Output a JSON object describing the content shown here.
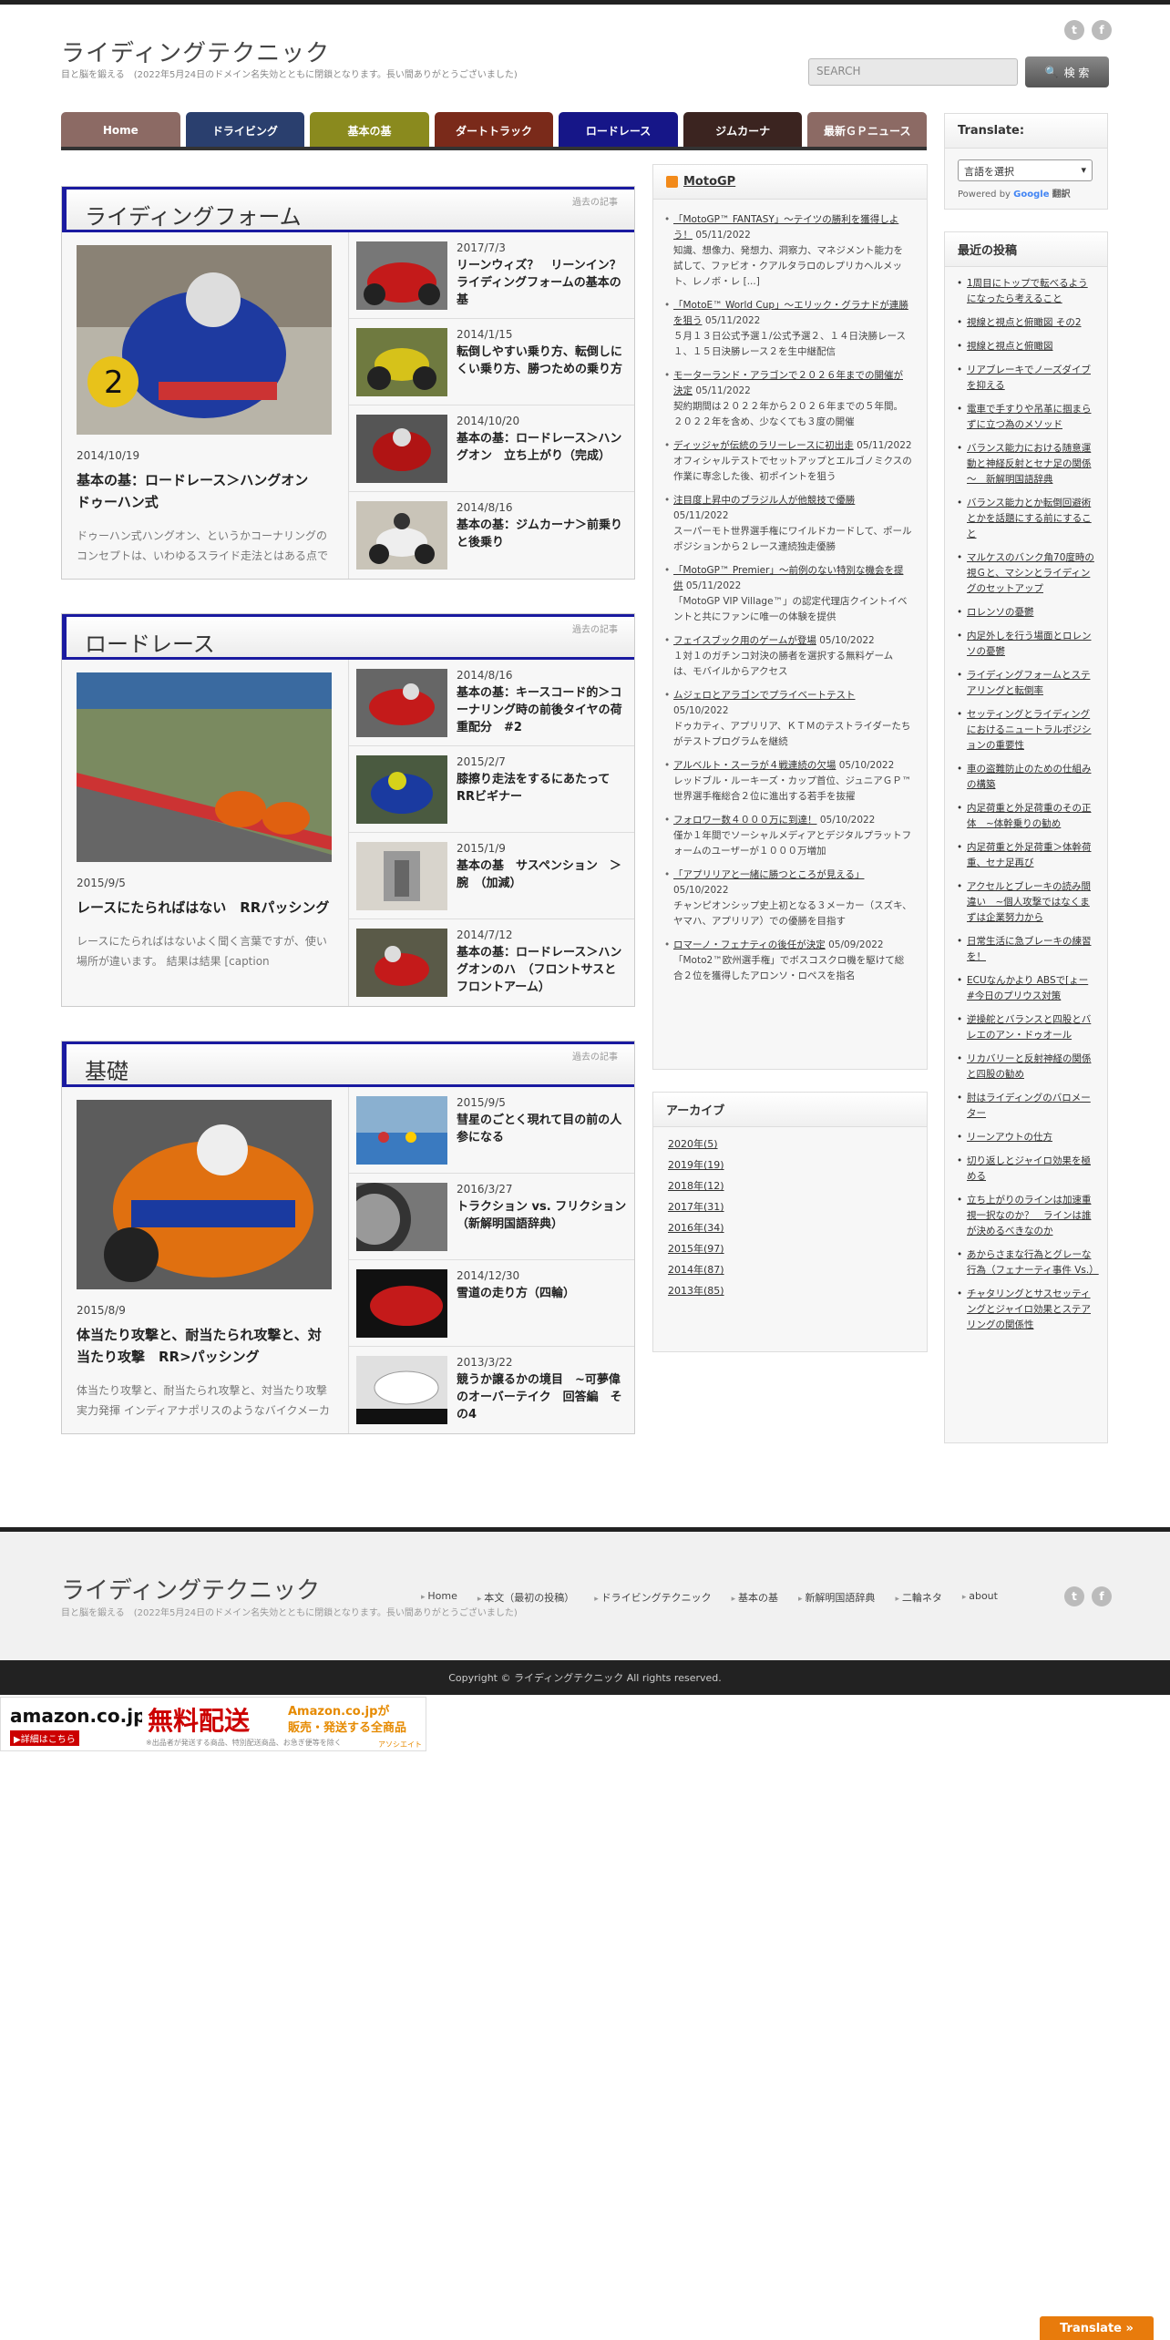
{
  "header": {
    "site_title": "ライディングテクニック",
    "site_desc": "目と脳を鍛える　(2022年5月24日のドメイン名失効とともに閉鎖となります。長い間ありがとうございました)",
    "search_placeholder": "SEARCH",
    "search_button": "検 索"
  },
  "nav": [
    {
      "label": "Home",
      "color": "#8c6a64"
    },
    {
      "label": "ドライビング",
      "color": "#2a3f6e"
    },
    {
      "label": "基本の基",
      "color": "#8a8a1e"
    },
    {
      "label": "ダートトラック",
      "color": "#7a2a1a"
    },
    {
      "label": "ロードレース",
      "color": "#161688"
    },
    {
      "label": "ジムカーナ",
      "color": "#3b2420"
    },
    {
      "label": "最新ＧＰニュース",
      "color": "#8c6a64"
    }
  ],
  "sections": [
    {
      "title": "ライディングフォーム",
      "more": "過去の記事",
      "feature": {
        "date": "2014/10/19",
        "title": "基本の基：ロードレース＞ハングオン　ドゥーハン式",
        "excerpt": "ドゥーハン式ハングオン、というかコーナリングのコンセプトは、いわゆるスライド走法とはある点で"
      },
      "items": [
        {
          "date": "2017/7/3",
          "title": "リーンウィズ？　リーンイン？　ライディングフォームの基本の基"
        },
        {
          "date": "2014/1/15",
          "title": "転倒しやすい乗り方、転倒しにくい乗り方、勝つための乗り方"
        },
        {
          "date": "2014/10/20",
          "title": "基本の基：ロードレース＞ハングオン　立ち上がり（完成）"
        },
        {
          "date": "2014/8/16",
          "title": "基本の基：ジムカーナ＞前乗りと後乗り"
        }
      ]
    },
    {
      "title": "ロードレース",
      "more": "過去の記事",
      "feature": {
        "date": "2015/9/5",
        "title": "レースにたらればはない　RRパッシング",
        "excerpt": "レースにたらればはないよく聞く言葉ですが、使い場所が違います。 結果は結果 [caption"
      },
      "items": [
        {
          "date": "2014/8/16",
          "title": "基本の基：キースコード的＞コーナリング時の前後タイヤの荷重配分　#2"
        },
        {
          "date": "2015/2/7",
          "title": "膝擦り走法をするにあたってRRビギナー"
        },
        {
          "date": "2015/1/9",
          "title": "基本の基　サスペンション　＞　腕　（加減）"
        },
        {
          "date": "2014/7/12",
          "title": "基本の基：ロードレース＞ハングオンのハ　（フロントサスとフロントアーム）"
        }
      ]
    },
    {
      "title": "基礎",
      "more": "過去の記事",
      "feature": {
        "date": "2015/8/9",
        "title": "体当たり攻撃と、耐当たられ攻撃と、対当たり攻撃　RR>パッシング",
        "excerpt": "体当たり攻撃と、耐当たられ攻撃と、対当たり攻撃 実力発揮 インディアナポリスのようなバイクメーカ"
      },
      "items": [
        {
          "date": "2015/9/5",
          "title": "彗星のごとく現れて目の前の人参になる"
        },
        {
          "date": "2016/3/27",
          "title": "トラクション vs. フリクション（新解明国語辞典）"
        },
        {
          "date": "2014/12/30",
          "title": "雪道の走り方（四輪）"
        },
        {
          "date": "2013/3/22",
          "title": "競うか譲るかの境目　~可夢偉のオーバーテイク　回答編　その4"
        }
      ]
    }
  ],
  "motogp": {
    "title": "MotoGP",
    "items": [
      {
        "link": "「MotoGP™ FANTASY」～テイツの勝利を獲得しよう！",
        "date": "05/11/2022",
        "text": "知識、想像力、発想力、洞察力、マネジメント能力を試して、ファビオ・クアルタラロのレプリカヘルメット、レノボ・レ [...]"
      },
      {
        "link": "「MotoE™ World Cup」～エリック・グラナドが連勝を狙う",
        "date": "05/11/2022",
        "text": "５月１３日公式予選１/公式予選２、１４日決勝レース１、１５日決勝レース２を生中継配信"
      },
      {
        "link": "モーターランド・アラゴンで２０２６年までの開催が決定",
        "date": "05/11/2022",
        "text": "契約期間は２０２２年から２０２６年までの５年間。２０２２年を含め、少なくても３度の開催"
      },
      {
        "link": "ディッジャが伝統のラリーレースに初出走",
        "date": "05/11/2022",
        "text": "オフィシャルテストでセットアップとエルゴノミクスの作業に専念した後、初ポイントを狙う"
      },
      {
        "link": "注目度上昇中のブラジル人が他競技で優勝",
        "date": "05/11/2022",
        "text": "スーパーモト世界選手権にワイルドカードして、ポールポジションから２レース連続独走優勝"
      },
      {
        "link": "「MotoGP™ Premier」～前例のない特別な機会を提供",
        "date": "05/11/2022",
        "text": "「MotoGP VIP Village™」の認定代理店クイントイベントと共にファンに唯一の体験を提供"
      },
      {
        "link": "フェイスブック用のゲームが登場",
        "date": "05/10/2022",
        "text": "１対１のガチンコ対決の勝者を選択する無料ゲームは、モバイルからアクセス"
      },
      {
        "link": "ムジェロとアラゴンでプライベートテスト",
        "date": "05/10/2022",
        "text": "ドゥカティ、アプリリア、ＫＴＭのテストライダーたちがテストプログラムを継続"
      },
      {
        "link": "アルベルト・スーラが４戦連続の欠場",
        "date": "05/10/2022",
        "text": "レッドブル・ルーキーズ・カップ首位、ジュニアＧＰ™世界選手権総合２位に進出する若手を抜擢"
      },
      {
        "link": "フォロワー数４０００万に到達！",
        "date": "05/10/2022",
        "text": "僅か１年間でソーシャルメディアとデジタルプラットフォームのユーザーが１０００万増加"
      },
      {
        "link": "「アプリリアと一緒に勝つところが見える」",
        "date": "05/10/2022",
        "text": "チャンピオンシップ史上初となる３メーカー（スズキ、ヤマハ、アプリリア）での優勝を目指す"
      },
      {
        "link": "ロマーノ・フェナティの後任が決定",
        "date": "05/09/2022",
        "text": "「Moto2™欧州選手権」でボスコスクロ機を駆けて総合２位を獲得したアロンソ・ロペスを指名"
      }
    ]
  },
  "archive": {
    "title": "アーカイブ",
    "items": [
      "2020年(5)",
      "2019年(19)",
      "2018年(12)",
      "2017年(31)",
      "2016年(34)",
      "2015年(97)",
      "2014年(87)",
      "2013年(85)"
    ]
  },
  "translate": {
    "title": "Translate:",
    "select": "言語を選択",
    "powered": "Powered by",
    "google": "Google",
    "yaku": "翻訳"
  },
  "recent": {
    "title": "最近の投稿",
    "items": [
      "1周目にトップで転べるようになったら考えること",
      "視線と視点と俯瞰図 その2",
      "視線と視点と俯瞰図",
      "リアブレーキでノーズダイブを抑える",
      "電車で手すりや吊革に掴まらずに立つ為のメソッド",
      "バランス能力における随意運動と神経反射とセナ足の関係～　新解明国語辞典",
      "バランス能力とか転倒回避術とかを話題にする前にすること",
      "マルケスのバンク角70度時の視Ｇと、マシンとライディングのセットアップ",
      "ロレンソの憂鬱",
      "内足外しを行う場面とロレンソの憂鬱",
      "ライディングフォームとステアリングと転倒率",
      "セッティングとライディングにおけるニュートラルポジションの重要性",
      "車の盗難防止のための仕組みの構築",
      "内足荷重と外足荷重のその正体　~体幹乗りの勧め",
      "内足荷重と外足荷重＞体幹荷重、セナ足再び",
      "アクセルとブレーキの読み間違い　~個人攻撃ではなくまずは企業努力から",
      "日常生活に急ブレーキの練習を！",
      "ECUなんかより ABSで[ょー#今日のプリウス対策",
      "逆操舵とバランスと四股とバレエのアン・ドゥオール",
      "リカバリーと反射神経の関係と四股の勧め",
      "肘はライディングのバロメーター",
      "リーンアウトの仕方",
      "切り返しとジャイロ効果を極める",
      "立ち上がりのラインは加速重視一択なのか？　ラインは誰が決めるべきなのか",
      "あからさまな行為とグレーな行為（フェナーティ事件 Vs.）",
      "チャタリングとサスセッティングとジャイロ効果とステアリングの関係性"
    ]
  },
  "footer": {
    "title": "ライディングテクニック",
    "desc": "目と脳を鍛える　(2022年5月24日のドメイン名失効とともに閉鎖となります。長い間ありがとうございました)",
    "links": [
      "Home",
      "本文（最初の投稿）",
      "ドライビングテクニック",
      "基本の基",
      "新解明国語辞典",
      "二輪ネタ",
      "about"
    ],
    "copyright": "Copyright ©  ライディングテクニック All rights reserved."
  },
  "amazon": {
    "logo": "amazon.co.jp",
    "detail": "▶詳細はこちら",
    "free": "無料配送",
    "sub1": "Amazon.co.jpが",
    "sub2": "販売・発送する全商品",
    "note": "※出品者が発送する商品、特別配送商品、お急ぎ便等を除く",
    "tag": "アソシエイト"
  },
  "translate_button": "Translate »"
}
